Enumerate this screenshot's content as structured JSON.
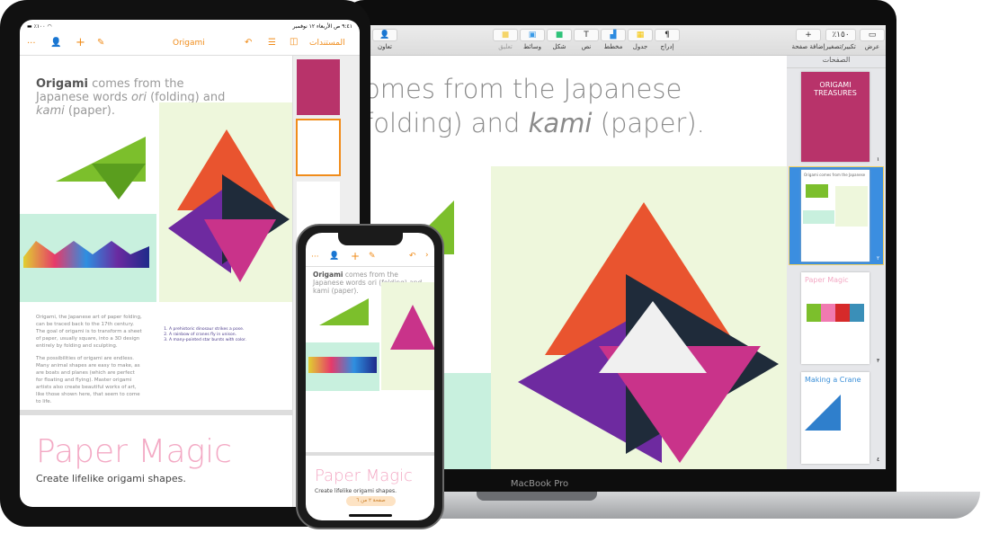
{
  "macbook": {
    "label": "MacBook Pro",
    "toolbar": [
      {
        "label": "عرض",
        "icon": "view-icon"
      },
      {
        "label": "تكبير/تصغير",
        "value": "٪١٥٠"
      },
      {
        "label": "إضافة صفحة",
        "icon": "plus-icon"
      },
      {
        "label": "إدراج",
        "icon": "paragraph-icon"
      },
      {
        "label": "جدول",
        "icon": "table-icon"
      },
      {
        "label": "مخطط",
        "icon": "chart-icon"
      },
      {
        "label": "نص",
        "icon": "text-icon"
      },
      {
        "label": "شكل",
        "icon": "shape-icon"
      },
      {
        "label": "وسائط",
        "icon": "media-icon"
      },
      {
        "label": "تعليق",
        "icon": "comment-icon"
      },
      {
        "label": "تعاون",
        "icon": "collaborate-icon"
      }
    ],
    "doc_line1": "omes from the Japanese",
    "doc_line2_a": "folding) and ",
    "doc_line2_b": "kami",
    "doc_line2_c": " (paper).",
    "sidebar_title": "الصفحات",
    "thumbs": [
      {
        "title": "ORIGAMI TREASURES",
        "num": "١"
      },
      {
        "title": "Origami comes from the Japanese",
        "num": "٢"
      },
      {
        "title": "Paper Magic",
        "num": "٣"
      },
      {
        "title": "Making a Crane",
        "num": "٤"
      }
    ]
  },
  "ipad": {
    "status_time": "٩:٤١ ص  الأربعاء ١٢ نوفمبر",
    "battery": "٪١٠٠",
    "documents": "المستندات",
    "title": "Origami",
    "heading_bold": "Origami",
    "heading_rest": " comes from the Japanese words ",
    "heading_ori": "ori",
    "heading_mid": " (folding) and ",
    "heading_kami": "kami",
    "heading_end": " (paper).",
    "para1": "Origami, the Japanese art of paper folding, can be traced back to the 17th century. The goal of origami is to transform a sheet of paper, usually square, into a 3D design entirely by folding and sculpting.",
    "para2": "The possibilities of origami are endless. Many animal shapes are easy to make, as are boats and planes (which are perfect for floating and flying). Master origami artists also create beautiful works of art, like those shown here, that seem to come to life.",
    "list": [
      "A prehistoric dinosaur strikes a pose.",
      "A rainbow of cranes fly in unison.",
      "A many-pointed star bursts with color."
    ],
    "page_num": "1",
    "paper_magic": "Paper Magic",
    "subtitle": "Create lifelike origami shapes."
  },
  "iphone": {
    "heading_bold": "Origami",
    "heading_rest": " comes from the Japanese words ori (folding) and kami (paper).",
    "paper_magic": "Paper Magic",
    "subtitle": "Create lifelike origami shapes.",
    "page_badge": "صفحة ٢ من ٦"
  },
  "colors": {
    "accent": "#f08c1a",
    "pink": "#f3a9c4",
    "cover": "#b8336a",
    "selection": "#3b8ee0"
  }
}
